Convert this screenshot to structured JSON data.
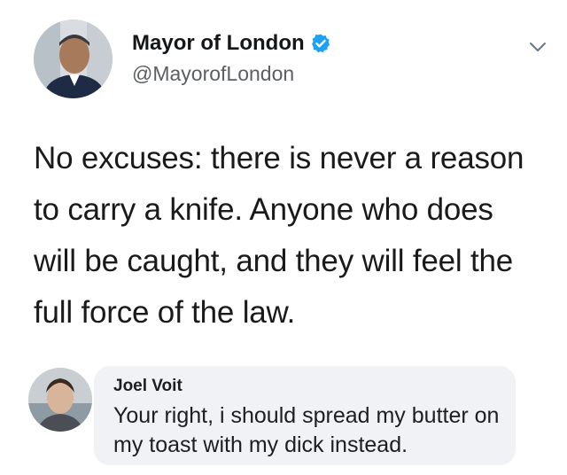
{
  "tweet": {
    "author": {
      "display_name": "Mayor of London",
      "handle": "@MayorofLondon",
      "verified": true
    },
    "text": "No excuses: there is never a reason to carry a knife. Anyone who does will be caught, and they will feel the full force of the law.",
    "menu_icon": "chevron-down-icon"
  },
  "reply": {
    "author": {
      "name": "Joel Voit"
    },
    "text": "Your right, i should spread my butter on my toast with my dick instead."
  },
  "colors": {
    "verified_blue": "#1da1f2",
    "bubble_bg": "#f0f2f5",
    "handle_gray": "#5b5f63"
  }
}
